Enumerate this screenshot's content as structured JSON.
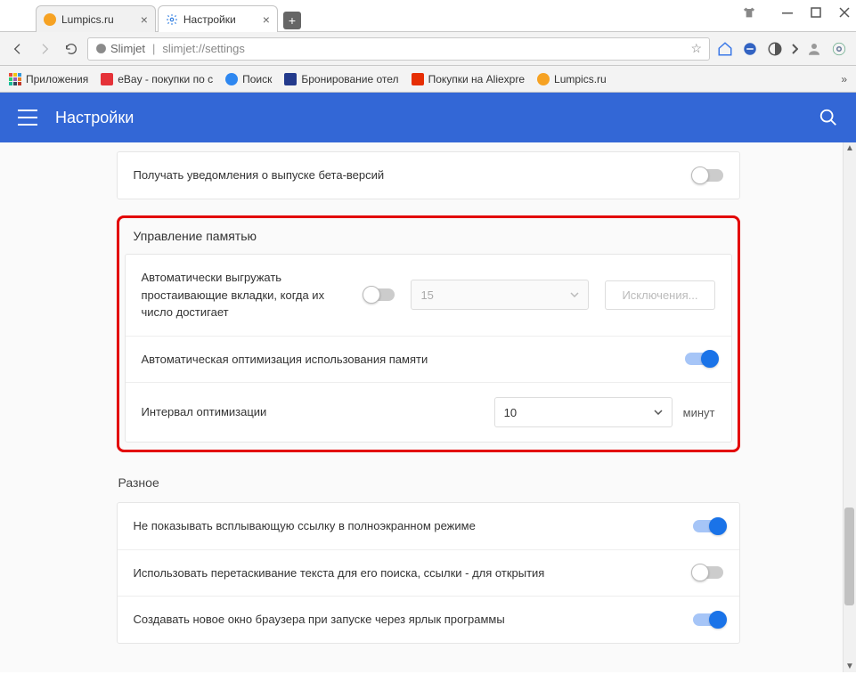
{
  "tabs": [
    {
      "title": "Lumpics.ru",
      "favicon_color": "#f6a223",
      "active": false
    },
    {
      "title": "Настройки",
      "favicon_color": "#2f7de1",
      "active": true
    }
  ],
  "address": {
    "secure_label": "Slimjet",
    "host": "slimjet://settings"
  },
  "bookmarks": {
    "apps_label": "Приложения",
    "items": [
      {
        "label": "eBay - покупки по с",
        "color": "#e53238"
      },
      {
        "label": "Поиск",
        "color": "#2e87f0"
      },
      {
        "label": "Бронирование отел",
        "color": "#233a8c"
      },
      {
        "label": "Покупки на Aliexpre",
        "color": "#e62e04"
      },
      {
        "label": "Lumpics.ru",
        "color": "#f6a223"
      }
    ]
  },
  "header": {
    "title": "Настройки"
  },
  "settings": {
    "beta": {
      "label": "Получать уведомления о выпуске бета-версий",
      "enabled": false
    },
    "memory": {
      "section_title": "Управление памятью",
      "auto_unload": {
        "label": "Автоматически выгружать простаивающие вкладки, когда их число достигает",
        "enabled": false,
        "threshold": "15",
        "exceptions_label": "Исключения..."
      },
      "auto_optimize": {
        "label": "Автоматическая оптимизация использования памяти",
        "enabled": true
      },
      "interval": {
        "label": "Интервал оптимизации",
        "value": "10",
        "unit": "минут"
      }
    },
    "misc": {
      "section_title": "Разное",
      "rows": [
        {
          "label": "Не показывать всплывающую ссылку в полноэкранном режиме",
          "enabled": true
        },
        {
          "label": "Использовать перетаскивание текста для его поиска, ссылки - для открытия",
          "enabled": false
        },
        {
          "label": "Создавать новое окно браузера при запуске через ярлык программы",
          "enabled": true
        }
      ]
    }
  }
}
